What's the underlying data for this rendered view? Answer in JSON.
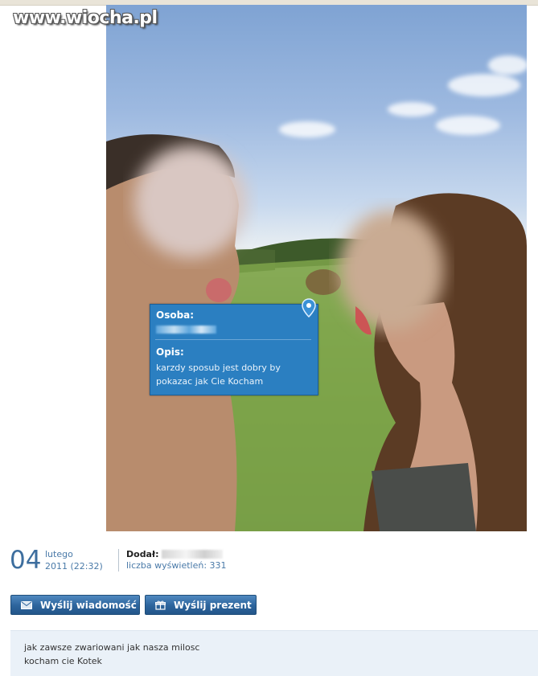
{
  "watermark": "www.wiocha.pl",
  "tag": {
    "person_label": "Osoba:",
    "description_label": "Opis:",
    "description_line1": "karzdy sposub jest dobry by",
    "description_line2": "pokazac jak Cie Kocham"
  },
  "meta": {
    "day": "04",
    "month": "lutego",
    "year_time": "2011 (22:32)",
    "added_by_label": "Dodał:",
    "views_text": "liczba wyświetleń: 331"
  },
  "buttons": {
    "send_message": "Wyślij wiadomość",
    "send_gift": "Wyślij prezent"
  },
  "description": {
    "line1": "jak zawsze zwariowani jak nasza milosc",
    "line2": "kocham cie Kotek"
  },
  "colors": {
    "accent": "#2b7fc1",
    "button": "#2c649c",
    "date": "#3d6e9e"
  }
}
